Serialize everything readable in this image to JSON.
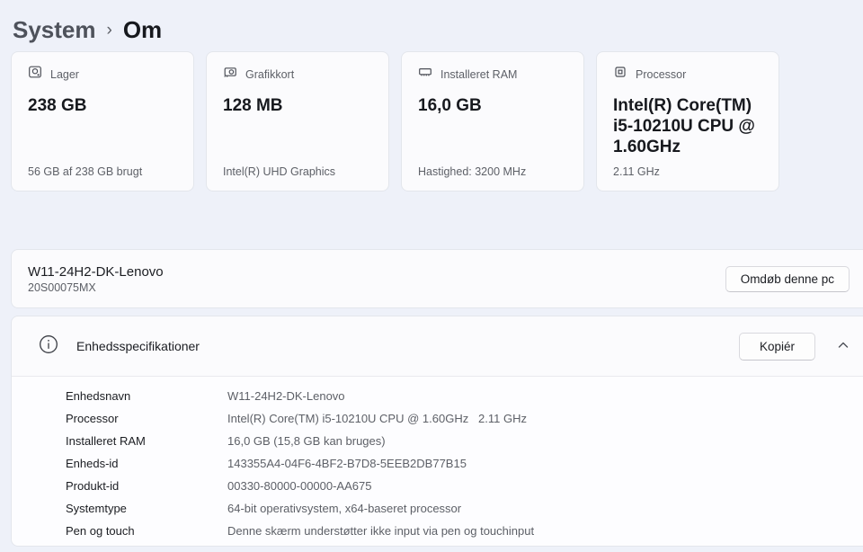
{
  "breadcrumb": {
    "parent": "System",
    "separator": "›",
    "current": "Om"
  },
  "cards": [
    {
      "icon": "storage-icon",
      "label": "Lager",
      "value": "238 GB",
      "caption": "56 GB af 238 GB brugt"
    },
    {
      "icon": "gpu-icon",
      "label": "Grafikkort",
      "value": "128 MB",
      "caption": "Intel(R) UHD Graphics"
    },
    {
      "icon": "ram-icon",
      "label": "Installeret RAM",
      "value": "16,0 GB",
      "caption": "Hastighed: 3200 MHz"
    },
    {
      "icon": "cpu-icon",
      "label": "Processor",
      "value": "Intel(R) Core(TM) i5-10210U CPU @ 1.60GHz",
      "caption": "2.11 GHz"
    }
  ],
  "device": {
    "name": "W11-24H2-DK-Lenovo",
    "model": "20S00075MX",
    "rename_button": "Omdøb denne pc"
  },
  "specs": {
    "icon": "info-icon",
    "title": "Enhedsspecifikationer",
    "copy_button": "Kopiér",
    "expander_icon": "chevron-up-icon",
    "rows": [
      {
        "label": "Enhedsnavn",
        "value": "W11-24H2-DK-Lenovo"
      },
      {
        "label": "Processor",
        "value": "Intel(R) Core(TM) i5-10210U CPU @ 1.60GHz   2.11 GHz"
      },
      {
        "label": "Installeret RAM",
        "value": "16,0 GB (15,8 GB kan bruges)"
      },
      {
        "label": "Enheds-id",
        "value": "143355A4-04F6-4BF2-B7D8-5EEB2DB77B15"
      },
      {
        "label": "Produkt-id",
        "value": "00330-80000-00000-AA675"
      },
      {
        "label": "Systemtype",
        "value": "64-bit operativsystem, x64-baseret processor"
      },
      {
        "label": "Pen og touch",
        "value": "Denne skærm understøtter ikke input via pen og touchinput"
      }
    ]
  },
  "colors": {
    "page_background": "#eef1f9",
    "card_background": "#fbfbfd",
    "card_border": "#e3e6ec",
    "primary_text": "#17191e",
    "secondary_text": "#5d6067"
  }
}
